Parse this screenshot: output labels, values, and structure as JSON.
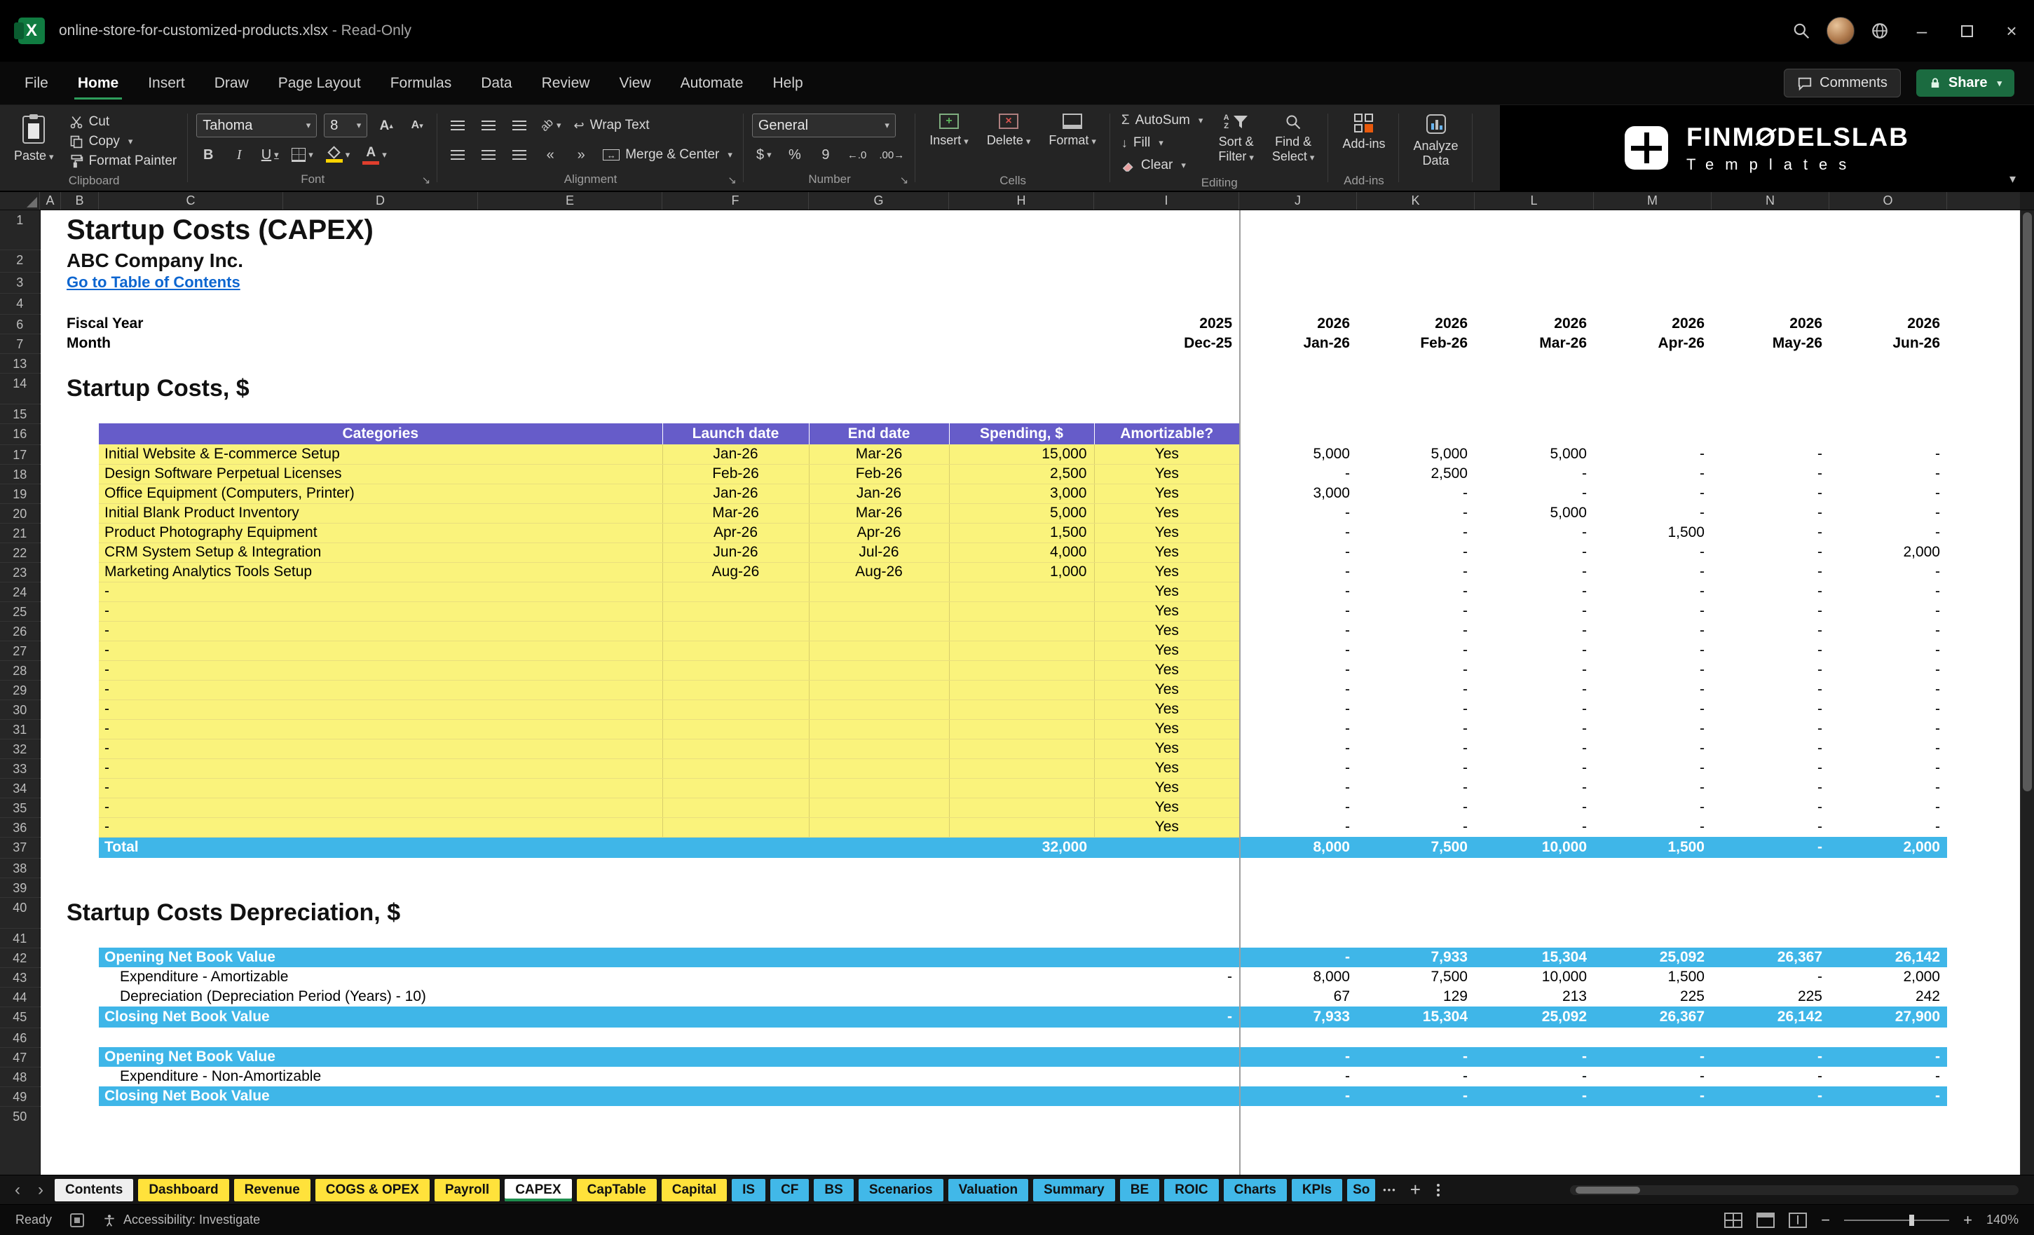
{
  "colors": {
    "accent_yellow": "#FAF37C",
    "accent_purple": "#665CC9",
    "accent_cyan": "#3FB6E8",
    "tab_yellow": "#FFE23B",
    "tab_blue": "#41B8E8",
    "excel_green": "#107C41",
    "link_blue": "#0D66D0"
  },
  "titlebar": {
    "filename": "online-store-for-customized-products.xlsx",
    "mode": "-  Read-Only"
  },
  "menubar": {
    "items": [
      "File",
      "Home",
      "Insert",
      "Draw",
      "Page Layout",
      "Formulas",
      "Data",
      "Review",
      "View",
      "Automate",
      "Help"
    ],
    "active": "Home",
    "comments_label": "Comments",
    "share_label": "Share"
  },
  "ribbon": {
    "paste": "Paste",
    "cut": "Cut",
    "copy": "Copy",
    "format_painter": "Format Painter",
    "clipboard": "Clipboard",
    "font_name": "Tahoma",
    "font_size": "8",
    "font": "Font",
    "wrap": "Wrap Text",
    "merge": "Merge & Center",
    "alignment": "Alignment",
    "number_format": "General",
    "number": "Number",
    "insert": "Insert",
    "delete": "Delete",
    "format": "Format",
    "cells": "Cells",
    "autosum": "AutoSum",
    "fill": "Fill",
    "clear": "Clear",
    "sort1": "Sort &",
    "sort2": "Filter",
    "find1": "Find &",
    "find2": "Select",
    "editing": "Editing",
    "addins": "Add-ins",
    "addins_group": "Add-ins",
    "analyze1": "Analyze",
    "analyze2": "Data"
  },
  "brand": {
    "name_pre": "FINM",
    "name_o": "O",
    "name_post": "DELSLAB",
    "subtitle": "Templates"
  },
  "sheet": {
    "columns": [
      "A",
      "B",
      "C",
      "D",
      "E",
      "F",
      "G",
      "H",
      "I",
      "J",
      "K",
      "L",
      "M",
      "N",
      "O"
    ],
    "table_headers": [
      "Categories",
      "Launch date",
      "End date",
      "Spending, $",
      "Amortizable?"
    ],
    "rows": [
      {
        "n": "1",
        "kind": "title",
        "text": "Startup Costs (CAPEX)",
        "h": 56
      },
      {
        "n": "2",
        "kind": "company",
        "text": "ABC Company Inc.",
        "h": 30
      },
      {
        "n": "3",
        "kind": "link",
        "text": "Go to Table of Contents",
        "h": 30
      },
      {
        "n": "4",
        "kind": "blank",
        "h": 30
      },
      {
        "n": "6",
        "kind": "months",
        "label": "Fiscal Year",
        "i": "2025",
        "vals": [
          "2026",
          "2026",
          "2026",
          "2026",
          "2026",
          "2026"
        ]
      },
      {
        "n": "7",
        "kind": "months",
        "label": "Month",
        "i": "Dec-25",
        "vals": [
          "Jan-26",
          "Feb-26",
          "Mar-26",
          "Apr-26",
          "May-26",
          "Jun-26"
        ]
      },
      {
        "n": "13",
        "kind": "blank"
      },
      {
        "n": "14",
        "kind": "heading",
        "text": "Startup Costs, $",
        "h": 44
      },
      {
        "n": "15",
        "kind": "blank"
      },
      {
        "n": "16",
        "kind": "thead",
        "h": 30
      },
      {
        "n": "17",
        "kind": "item",
        "cat": "Initial Website & E-commerce Setup",
        "launch": "Jan-26",
        "end": "Mar-26",
        "spend": "15,000",
        "amort": "Yes",
        "vals": [
          "5,000",
          "5,000",
          "5,000",
          "-",
          "-",
          "-"
        ]
      },
      {
        "n": "18",
        "kind": "item",
        "cat": "Design Software Perpetual Licenses",
        "launch": "Feb-26",
        "end": "Feb-26",
        "spend": "2,500",
        "amort": "Yes",
        "vals": [
          "-",
          "2,500",
          "-",
          "-",
          "-",
          "-"
        ]
      },
      {
        "n": "19",
        "kind": "item",
        "cat": "Office Equipment (Computers, Printer)",
        "launch": "Jan-26",
        "end": "Jan-26",
        "spend": "3,000",
        "amort": "Yes",
        "vals": [
          "3,000",
          "-",
          "-",
          "-",
          "-",
          "-"
        ]
      },
      {
        "n": "20",
        "kind": "item",
        "cat": "Initial Blank Product Inventory",
        "launch": "Mar-26",
        "end": "Mar-26",
        "spend": "5,000",
        "amort": "Yes",
        "vals": [
          "-",
          "-",
          "5,000",
          "-",
          "-",
          "-"
        ]
      },
      {
        "n": "21",
        "kind": "item",
        "cat": "Product Photography Equipment",
        "launch": "Apr-26",
        "end": "Apr-26",
        "spend": "1,500",
        "amort": "Yes",
        "vals": [
          "-",
          "-",
          "-",
          "1,500",
          "-",
          "-"
        ]
      },
      {
        "n": "22",
        "kind": "item",
        "cat": "CRM System Setup & Integration",
        "launch": "Jun-26",
        "end": "Jul-26",
        "spend": "4,000",
        "amort": "Yes",
        "vals": [
          "-",
          "-",
          "-",
          "-",
          "-",
          "2,000"
        ]
      },
      {
        "n": "23",
        "kind": "item",
        "cat": "Marketing Analytics Tools Setup",
        "launch": "Aug-26",
        "end": "Aug-26",
        "spend": "1,000",
        "amort": "Yes",
        "vals": [
          "-",
          "-",
          "-",
          "-",
          "-",
          "-"
        ]
      },
      {
        "n": "24",
        "kind": "item",
        "cat": "-",
        "launch": "",
        "end": "",
        "spend": "",
        "amort": "Yes",
        "vals": [
          "-",
          "-",
          "-",
          "-",
          "-",
          "-"
        ]
      },
      {
        "n": "25",
        "kind": "item",
        "cat": "-",
        "launch": "",
        "end": "",
        "spend": "",
        "amort": "Yes",
        "vals": [
          "-",
          "-",
          "-",
          "-",
          "-",
          "-"
        ]
      },
      {
        "n": "26",
        "kind": "item",
        "cat": "-",
        "launch": "",
        "end": "",
        "spend": "",
        "amort": "Yes",
        "vals": [
          "-",
          "-",
          "-",
          "-",
          "-",
          "-"
        ]
      },
      {
        "n": "27",
        "kind": "item",
        "cat": "-",
        "launch": "",
        "end": "",
        "spend": "",
        "amort": "Yes",
        "vals": [
          "-",
          "-",
          "-",
          "-",
          "-",
          "-"
        ]
      },
      {
        "n": "28",
        "kind": "item",
        "cat": "-",
        "launch": "",
        "end": "",
        "spend": "",
        "amort": "Yes",
        "vals": [
          "-",
          "-",
          "-",
          "-",
          "-",
          "-"
        ]
      },
      {
        "n": "29",
        "kind": "item",
        "cat": "-",
        "launch": "",
        "end": "",
        "spend": "",
        "amort": "Yes",
        "vals": [
          "-",
          "-",
          "-",
          "-",
          "-",
          "-"
        ]
      },
      {
        "n": "30",
        "kind": "item",
        "cat": "-",
        "launch": "",
        "end": "",
        "spend": "",
        "amort": "Yes",
        "vals": [
          "-",
          "-",
          "-",
          "-",
          "-",
          "-"
        ]
      },
      {
        "n": "31",
        "kind": "item",
        "cat": "-",
        "launch": "",
        "end": "",
        "spend": "",
        "amort": "Yes",
        "vals": [
          "-",
          "-",
          "-",
          "-",
          "-",
          "-"
        ]
      },
      {
        "n": "32",
        "kind": "item",
        "cat": "-",
        "launch": "",
        "end": "",
        "spend": "",
        "amort": "Yes",
        "vals": [
          "-",
          "-",
          "-",
          "-",
          "-",
          "-"
        ]
      },
      {
        "n": "33",
        "kind": "item",
        "cat": "-",
        "launch": "",
        "end": "",
        "spend": "",
        "amort": "Yes",
        "vals": [
          "-",
          "-",
          "-",
          "-",
          "-",
          "-"
        ]
      },
      {
        "n": "34",
        "kind": "item",
        "cat": "-",
        "launch": "",
        "end": "",
        "spend": "",
        "amort": "Yes",
        "vals": [
          "-",
          "-",
          "-",
          "-",
          "-",
          "-"
        ]
      },
      {
        "n": "35",
        "kind": "item",
        "cat": "-",
        "launch": "",
        "end": "",
        "spend": "",
        "amort": "Yes",
        "vals": [
          "-",
          "-",
          "-",
          "-",
          "-",
          "-"
        ]
      },
      {
        "n": "36",
        "kind": "item",
        "cat": "-",
        "launch": "",
        "end": "",
        "spend": "",
        "amort": "Yes",
        "vals": [
          "-",
          "-",
          "-",
          "-",
          "-",
          "-"
        ]
      },
      {
        "n": "37",
        "kind": "total",
        "label": "Total",
        "spend": "32,000",
        "vals": [
          "8,000",
          "7,500",
          "10,000",
          "1,500",
          "-",
          "2,000"
        ],
        "h": 30
      },
      {
        "n": "38",
        "kind": "blank"
      },
      {
        "n": "39",
        "kind": "blank"
      },
      {
        "n": "40",
        "kind": "heading",
        "text": "Startup Costs Depreciation, $",
        "h": 44
      },
      {
        "n": "41",
        "kind": "blank"
      },
      {
        "n": "42",
        "kind": "band",
        "label": "Opening Net Book Value",
        "i": "",
        "vals": [
          "-",
          "7,933",
          "15,304",
          "25,092",
          "26,367",
          "26,142"
        ]
      },
      {
        "n": "43",
        "kind": "plain",
        "label": "Expenditure - Amortizable",
        "i": "-",
        "vals": [
          "8,000",
          "7,500",
          "10,000",
          "1,500",
          "-",
          "2,000"
        ]
      },
      {
        "n": "44",
        "kind": "plain",
        "label": "Depreciation (Depreciation Period (Years) - 10)",
        "i": "",
        "vals": [
          "67",
          "129",
          "213",
          "225",
          "225",
          "242"
        ]
      },
      {
        "n": "45",
        "kind": "band",
        "label": "Closing Net Book Value",
        "i": "-",
        "vals": [
          "7,933",
          "15,304",
          "25,092",
          "26,367",
          "26,142",
          "27,900"
        ],
        "h": 30
      },
      {
        "n": "46",
        "kind": "blank"
      },
      {
        "n": "47",
        "kind": "band",
        "label": "Opening Net Book Value",
        "i": "",
        "vals": [
          "-",
          "-",
          "-",
          "-",
          "-",
          "-"
        ]
      },
      {
        "n": "48",
        "kind": "plain",
        "label": "Expenditure - Non-Amortizable",
        "i": "",
        "vals": [
          "-",
          "-",
          "-",
          "-",
          "-",
          "-"
        ]
      },
      {
        "n": "49",
        "kind": "band",
        "label": "Closing Net Book Value",
        "i": "",
        "vals": [
          "-",
          "-",
          "-",
          "-",
          "-",
          "-"
        ]
      },
      {
        "n": "50",
        "kind": "blank",
        "h": 100
      }
    ]
  },
  "tabs": {
    "items": [
      {
        "label": "Contents",
        "color": "#EFEFEF"
      },
      {
        "label": "Dashboard",
        "color": "#FFE23B"
      },
      {
        "label": "Revenue",
        "color": "#FFE23B"
      },
      {
        "label": "COGS & OPEX",
        "color": "#FFE23B"
      },
      {
        "label": "Payroll",
        "color": "#FFE23B"
      },
      {
        "label": "CAPEX",
        "color": "#FFFFFF",
        "active": true
      },
      {
        "label": "CapTable",
        "color": "#FFE23B"
      },
      {
        "label": "Capital",
        "color": "#FFE23B"
      },
      {
        "label": "IS",
        "color": "#41B8E8"
      },
      {
        "label": "CF",
        "color": "#41B8E8"
      },
      {
        "label": "BS",
        "color": "#41B8E8"
      },
      {
        "label": "Scenarios",
        "color": "#41B8E8"
      },
      {
        "label": "Valuation",
        "color": "#41B8E8"
      },
      {
        "label": "Summary",
        "color": "#41B8E8"
      },
      {
        "label": "BE",
        "color": "#41B8E8"
      },
      {
        "label": "ROIC",
        "color": "#41B8E8"
      },
      {
        "label": "Charts",
        "color": "#41B8E8"
      },
      {
        "label": "KPIs",
        "color": "#41B8E8"
      },
      {
        "label": "So",
        "color": "#41B8E8",
        "truncated": true
      }
    ]
  },
  "statusbar": {
    "ready": "Ready",
    "accessibility": "Accessibility: Investigate",
    "zoom": "140%"
  }
}
